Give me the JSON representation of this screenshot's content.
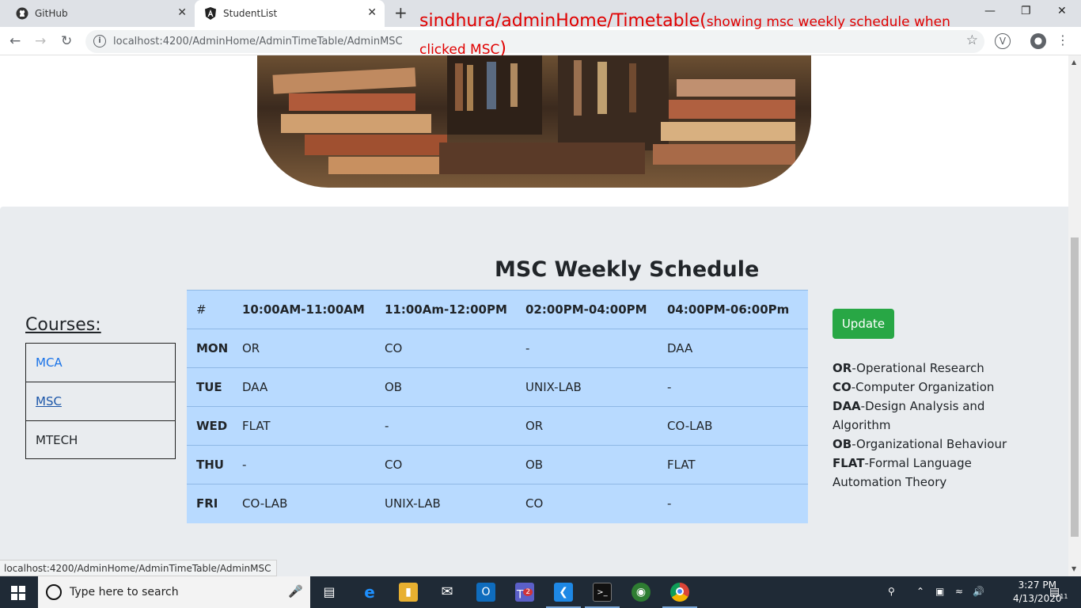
{
  "browser": {
    "tabs": [
      {
        "title": "GitHub",
        "close": "✕"
      },
      {
        "title": "StudentList",
        "close": "✕"
      }
    ],
    "new_tab": "+",
    "url": "localhost:4200/AdminHome/AdminTimeTable/AdminMSC",
    "status_url": "localhost:4200/AdminHome/AdminTimeTable/AdminMSC",
    "window_controls": {
      "minimize": "—",
      "restore": "❐",
      "close": "✕"
    }
  },
  "annotation": {
    "main": "sindhura/adminHome/Timetable(",
    "sub": "showing msc weekly schedule when",
    "sub2": "clicked MSC",
    "close_paren": ")"
  },
  "page": {
    "heading": "MSC Weekly Schedule",
    "courses_title": "Courses:",
    "courses": [
      "MCA",
      "MSC",
      "MTECH"
    ],
    "update_label": "Update"
  },
  "table": {
    "headers": [
      "#",
      "10:00AM-11:00AM",
      "11:00Am-12:00PM",
      "02:00PM-04:00PM",
      "04:00PM-06:00Pm"
    ],
    "rows": [
      {
        "day": "MON",
        "cells": [
          "OR",
          "CO",
          "-",
          "DAA"
        ]
      },
      {
        "day": "TUE",
        "cells": [
          "DAA",
          "OB",
          "UNIX-LAB",
          "-"
        ]
      },
      {
        "day": "WED",
        "cells": [
          "FLAT",
          "-",
          "OR",
          "CO-LAB"
        ]
      },
      {
        "day": "THU",
        "cells": [
          "-",
          "CO",
          "OB",
          "FLAT"
        ]
      },
      {
        "day": "FRI",
        "cells": [
          "CO-LAB",
          "UNIX-LAB",
          "CO",
          "-"
        ]
      }
    ]
  },
  "legend": [
    {
      "abbr": "OR",
      "text": "-Operational Research"
    },
    {
      "abbr": "CO",
      "text": "-Computer Organization"
    },
    {
      "abbr": "DAA",
      "text": "-Design Analysis and Algorithm"
    },
    {
      "abbr": "OB",
      "text": "-Organizational Behaviour"
    },
    {
      "abbr": "FLAT",
      "text": "-Formal Language Automation Theory"
    }
  ],
  "taskbar": {
    "search_placeholder": "Type here to search",
    "time": "3:27 PM",
    "date": "4/13/2020",
    "teams_badge": "2",
    "notification_count": "11"
  },
  "colors": {
    "table_bg": "#b8daff",
    "update_bg": "#28a745",
    "annotation": "#e00000",
    "content_bg": "#e9ecef"
  }
}
